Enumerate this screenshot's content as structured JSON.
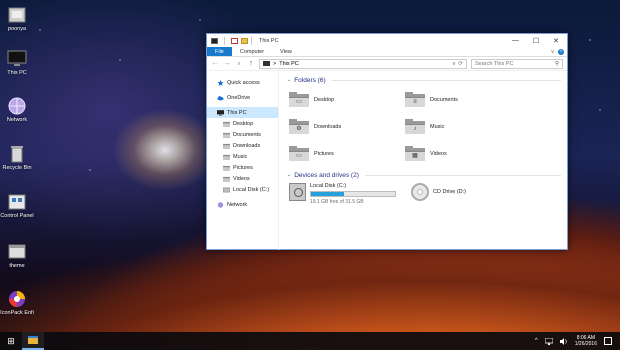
{
  "desktop": {
    "icons": [
      {
        "label": "poonya",
        "icon": "user-folder-icon"
      },
      {
        "label": "This PC",
        "icon": "computer-icon"
      },
      {
        "label": "Network",
        "icon": "network-icon"
      },
      {
        "label": "Recycle Bin",
        "icon": "recycle-bin-icon"
      },
      {
        "label": "Control Panel",
        "icon": "control-panel-icon"
      },
      {
        "label": "theme",
        "icon": "theme-icon"
      },
      {
        "label": "IconPack Enfi",
        "icon": "iconpack-icon"
      }
    ]
  },
  "window": {
    "title": "This PC",
    "controls": {
      "minimize": "—",
      "maximize": "☐",
      "close": "✕"
    },
    "ribbon": {
      "tabs": [
        {
          "label": "File"
        },
        {
          "label": "Computer"
        },
        {
          "label": "View"
        }
      ],
      "expand": "v",
      "help": "?"
    },
    "address": {
      "back": "←",
      "forward": "→",
      "recent": "v",
      "up": "↑",
      "separator": ">",
      "path": "This PC",
      "dropdown": "v",
      "refresh": "⟳"
    },
    "search": {
      "placeholder": "Search This PC",
      "icon": "⚲"
    },
    "nav": {
      "items": [
        {
          "label": "Quick access",
          "icon": "star-icon",
          "level": 0
        },
        {
          "label": "OneDrive",
          "icon": "cloud-icon",
          "level": 0
        },
        {
          "label": "This PC",
          "icon": "computer-icon",
          "level": 0,
          "selected": true
        },
        {
          "label": "Desktop",
          "icon": "folder-icon",
          "level": 1
        },
        {
          "label": "Documents",
          "icon": "folder-icon",
          "level": 1
        },
        {
          "label": "Downloads",
          "icon": "folder-icon",
          "level": 1
        },
        {
          "label": "Music",
          "icon": "folder-icon",
          "level": 1
        },
        {
          "label": "Pictures",
          "icon": "folder-icon",
          "level": 1
        },
        {
          "label": "Videos",
          "icon": "folder-icon",
          "level": 1
        },
        {
          "label": "Local Disk (C:)",
          "icon": "drive-icon",
          "level": 1
        },
        {
          "label": "Network",
          "icon": "network-icon",
          "level": 0
        }
      ]
    },
    "folders_section": {
      "heading": "Folders (6)",
      "items": [
        {
          "label": "Desktop",
          "symbol": "▭"
        },
        {
          "label": "Documents",
          "symbol": "≡"
        },
        {
          "label": "Downloads",
          "symbol": "⚙"
        },
        {
          "label": "Music",
          "symbol": "♪"
        },
        {
          "label": "Pictures",
          "symbol": "▭"
        },
        {
          "label": "Videos",
          "symbol": "▦"
        }
      ]
    },
    "drives_section": {
      "heading": "Devices and drives (2)",
      "items": [
        {
          "label": "Local Disk (C:)",
          "free_text": "19.1 GB free of 31.5 GB",
          "used_fraction": 0.39,
          "type": "hdd"
        },
        {
          "label": "CD Drive (D:)",
          "type": "cd"
        }
      ]
    }
  },
  "taskbar": {
    "start_icon": "⊞",
    "tray": {
      "chevron": "^",
      "time": "8:06 AM",
      "date": "1/26/2016"
    }
  },
  "colors": {
    "accent": "#1979ca",
    "selection": "#cce8ff",
    "heading": "#1e3287",
    "bar_fill": "#26a0da"
  }
}
